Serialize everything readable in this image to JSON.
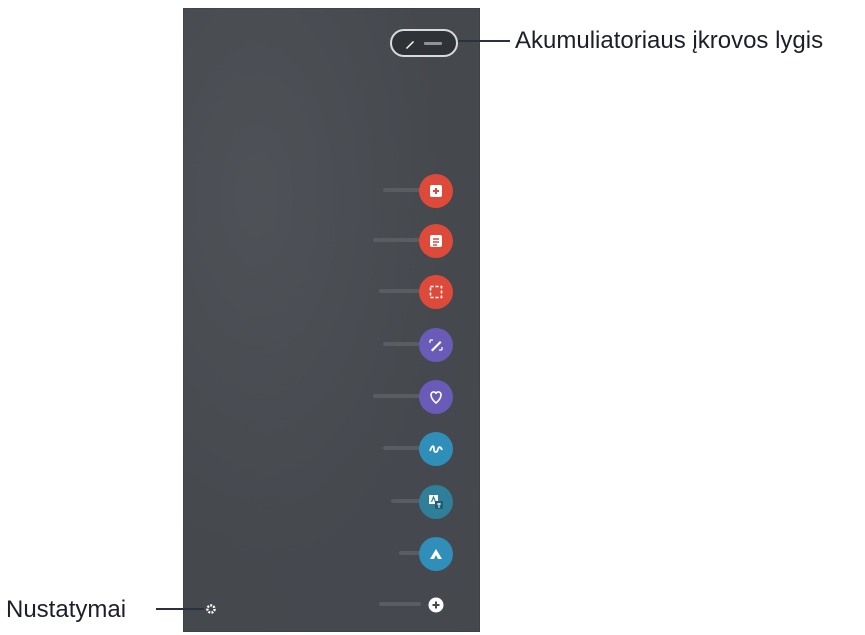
{
  "callouts": {
    "battery": "Akumuliatoriaus įkrovos lygis",
    "settings": "Nustatymai"
  },
  "air_command": {
    "items": [
      {
        "icon": "create-note-icon",
        "color": "#dd4a3a"
      },
      {
        "icon": "view-notes-icon",
        "color": "#dd4a3a"
      },
      {
        "icon": "smart-select-icon",
        "color": "#dd4a3a"
      },
      {
        "icon": "screen-write-icon",
        "color": "#6a5bb8"
      },
      {
        "icon": "live-message-icon",
        "color": "#6a5bb8"
      },
      {
        "icon": "ar-doodle-icon",
        "color": "#2f8fb8"
      },
      {
        "icon": "translate-icon",
        "color": "#2f7f9a"
      },
      {
        "icon": "bixby-vision-icon",
        "color": "#2f8fb8"
      },
      {
        "icon": "add-shortcut-icon",
        "color": "#ffffff"
      }
    ],
    "settings_icon": "gear-icon",
    "pen_icon": "pen-icon"
  },
  "colors": {
    "panel": "#45484d",
    "callout": "#2b3140"
  }
}
